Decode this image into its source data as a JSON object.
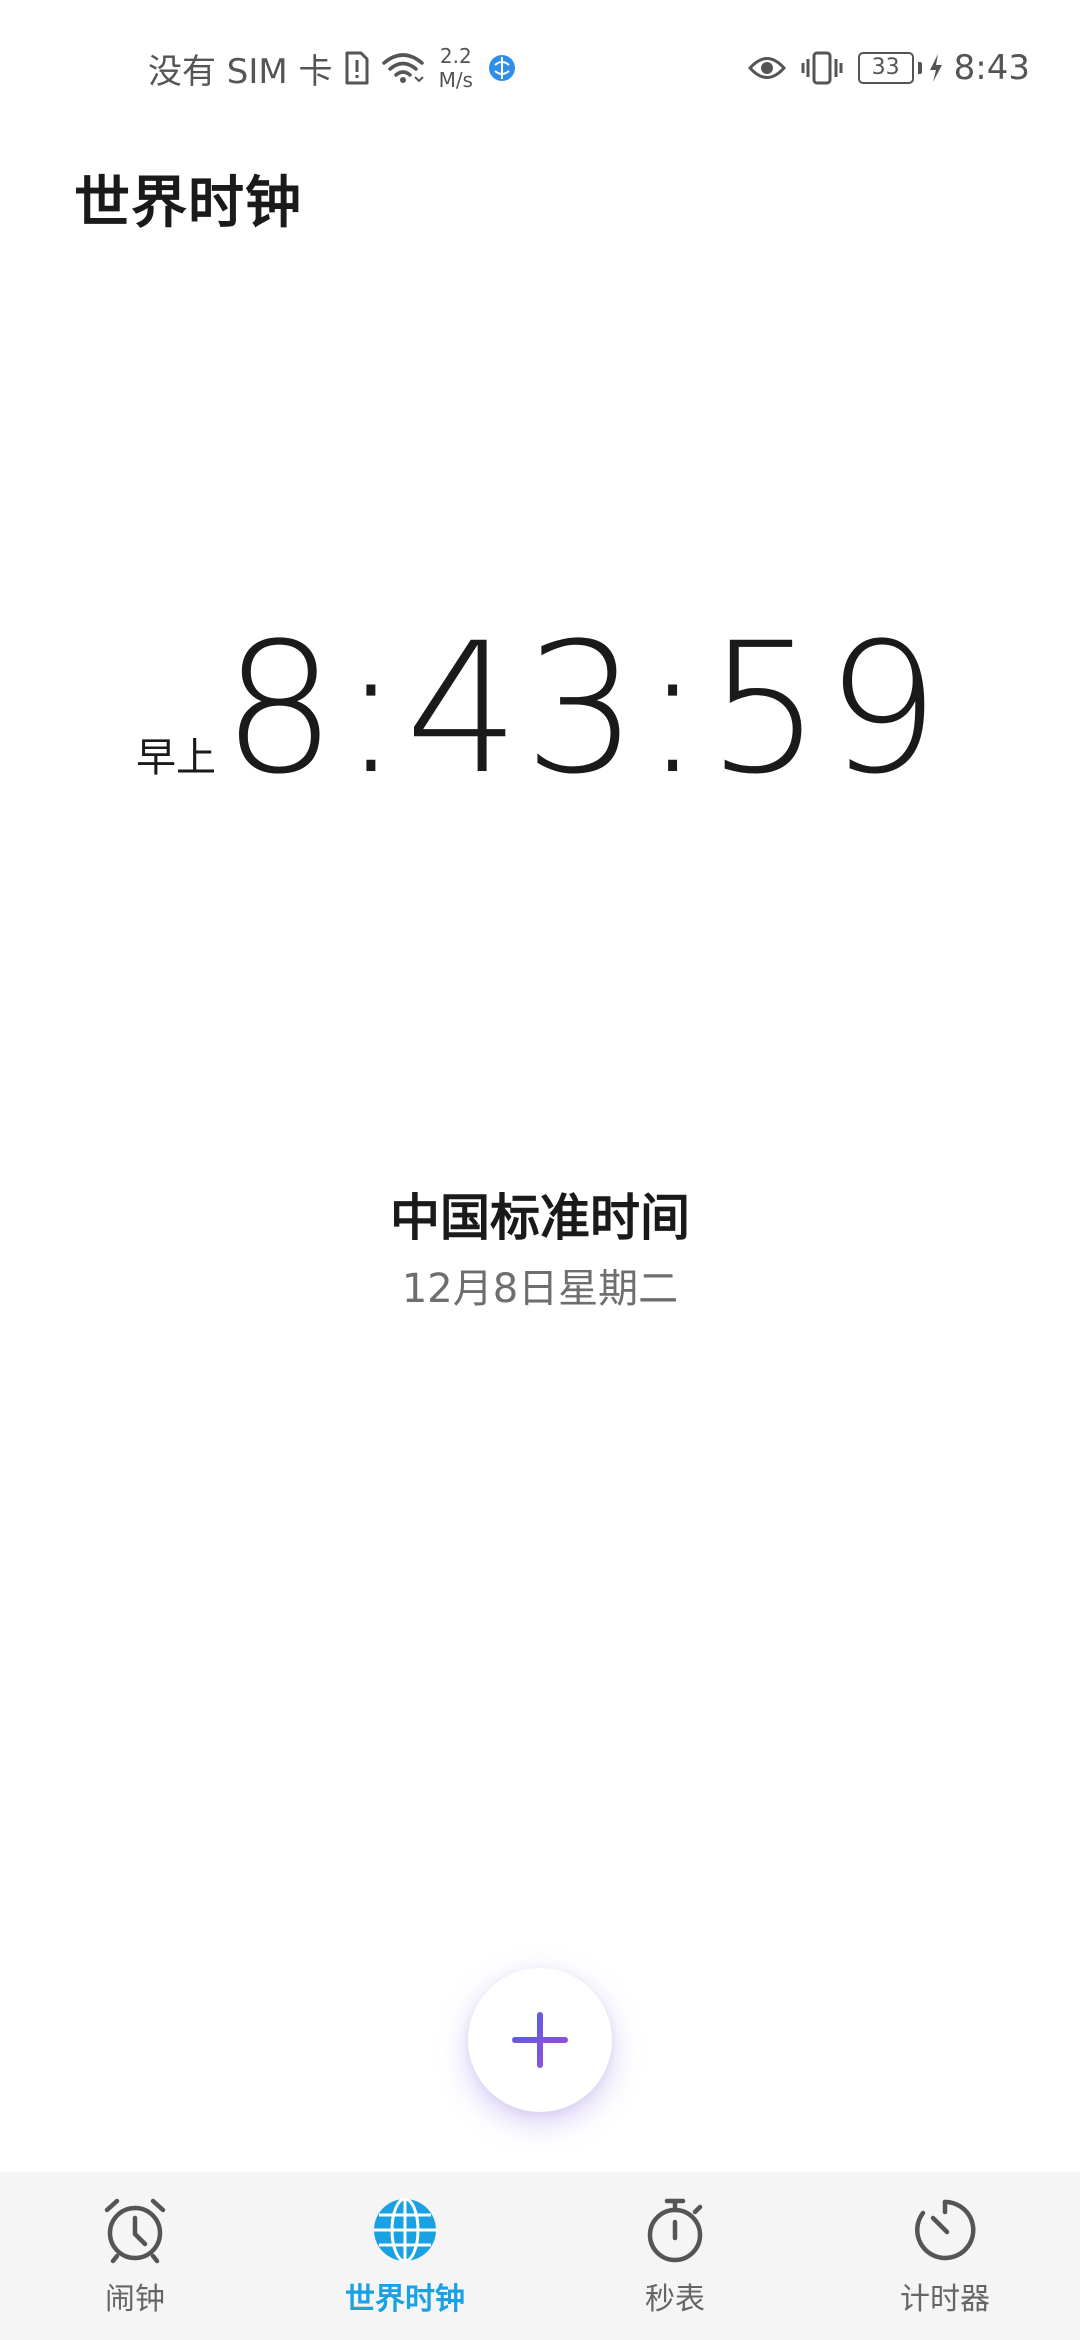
{
  "status_bar": {
    "carrier": "没有 SIM 卡",
    "net_speed_value": "2.2",
    "net_speed_unit": "M/s",
    "battery_level": "33",
    "time": "8:43",
    "icons_left": [
      "sim-alert-icon",
      "wifi-icon",
      "app-notification-icon"
    ],
    "icons_right": [
      "eye-comfort-icon",
      "vibrate-icon",
      "battery-icon",
      "charging-icon"
    ]
  },
  "header": {
    "title": "世界时钟"
  },
  "clock": {
    "ampm": "早上",
    "time": "8:43:59"
  },
  "location": {
    "city": "中国标准时间",
    "date": "12月8日星期二"
  },
  "fab": {
    "icon": "plus-icon"
  },
  "bottom_nav": {
    "items": [
      {
        "label": "闹钟",
        "icon": "alarm-clock-icon",
        "active": false
      },
      {
        "label": "世界时钟",
        "icon": "globe-icon",
        "active": true
      },
      {
        "label": "秒表",
        "icon": "stopwatch-icon",
        "active": false
      },
      {
        "label": "计时器",
        "icon": "timer-icon",
        "active": false
      }
    ]
  },
  "colors": {
    "accent": "#1aa1e3",
    "fab_plus_start": "#4a62e0",
    "fab_plus_end": "#a24ad8",
    "text_primary": "#1a1a1a",
    "text_secondary": "#6e6e6e",
    "nav_background": "#f5f5f5"
  }
}
